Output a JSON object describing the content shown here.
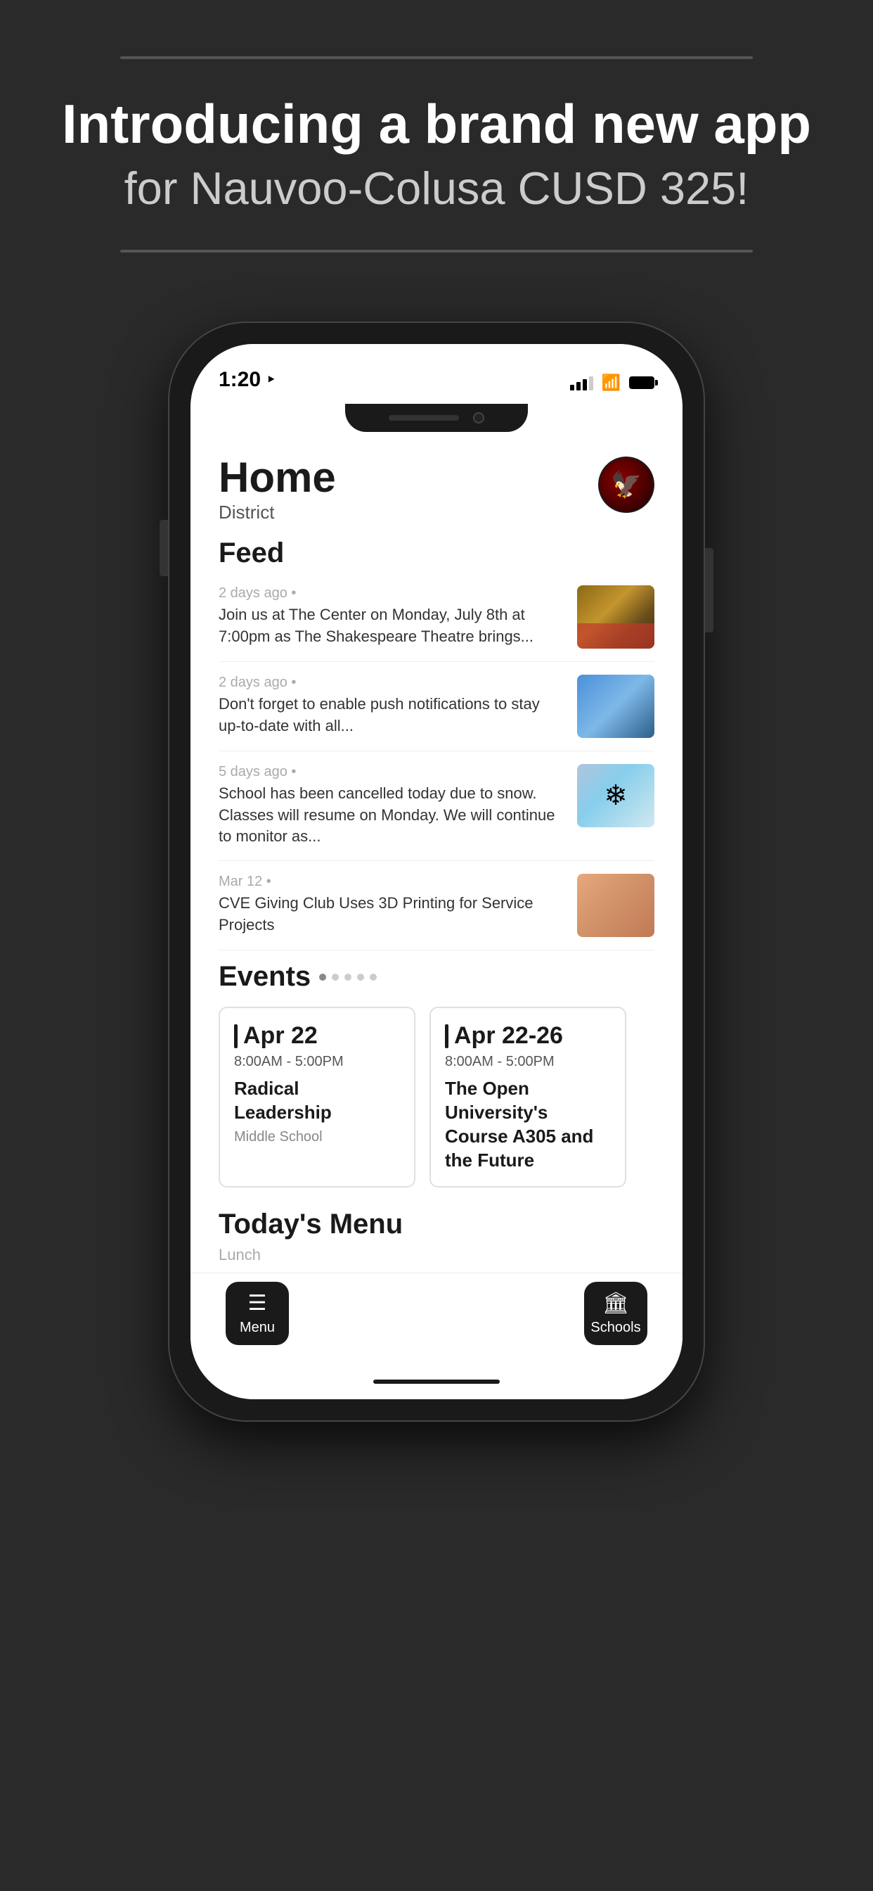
{
  "header": {
    "divider": true,
    "headline": "Introducing a brand new app",
    "subheadline": "for Nauvoo-Colusa CUSD 325!"
  },
  "phone": {
    "status_bar": {
      "time": "1:20",
      "arrow": "▲",
      "wifi": "WiFi",
      "battery": "full"
    },
    "app": {
      "title": "Home",
      "subtitle": "District",
      "avatar_emoji": "🦅",
      "sections": {
        "feed": {
          "label": "Feed",
          "items": [
            {
              "timestamp": "2 days ago •",
              "text": "Join us at The Center on Monday, July 8th at 7:00pm as The Shakespeare Theatre brings...",
              "thumb": "theatre"
            },
            {
              "timestamp": "2 days ago •",
              "text": "Don't forget to enable push notifications to stay up-to-date with all...",
              "thumb": "phone"
            },
            {
              "timestamp": "5 days ago •",
              "text": "School has been cancelled today due to snow. Classes will resume on Monday. We will continue to monitor as...",
              "thumb": "snow"
            },
            {
              "timestamp": "Mar 12 •",
              "text": "CVE Giving Club Uses 3D Printing for Service Projects",
              "thumb": "art"
            }
          ]
        },
        "events": {
          "label": "Events",
          "dots": 5,
          "active_dot": 0,
          "cards": [
            {
              "date": "Apr 22",
              "time": "8:00AM  -  5:00PM",
              "name": "Radical Leadership",
              "location": "Middle School"
            },
            {
              "date": "Apr 22-26",
              "time": "8:00AM  -  5:00PM",
              "name": "The Open University's Course A305 and the Future",
              "location": ""
            }
          ]
        },
        "menu": {
          "label": "Today's Menu"
        }
      },
      "bottom_nav": {
        "left": {
          "icon": "☰",
          "label": "Menu"
        },
        "right": {
          "icon": "🏛",
          "label": "Schools"
        }
      }
    }
  }
}
